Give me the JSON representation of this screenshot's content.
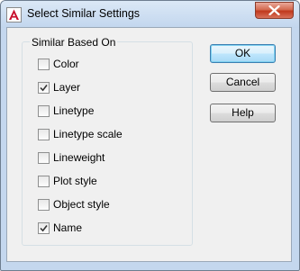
{
  "window": {
    "title": "Select Similar Settings"
  },
  "group": {
    "label": "Similar Based On"
  },
  "options": [
    {
      "label": "Color",
      "checked": false
    },
    {
      "label": "Layer",
      "checked": true
    },
    {
      "label": "Linetype",
      "checked": false
    },
    {
      "label": "Linetype scale",
      "checked": false
    },
    {
      "label": "Lineweight",
      "checked": false
    },
    {
      "label": "Plot style",
      "checked": false
    },
    {
      "label": "Object style",
      "checked": false
    },
    {
      "label": "Name",
      "checked": true
    }
  ],
  "buttons": {
    "ok": "OK",
    "cancel": "Cancel",
    "help": "Help"
  },
  "colors": {
    "title_bar": "#c4d7ee",
    "close": "#c0391d",
    "app_icon": "#c8102e",
    "default_button": "#3c7fb1"
  },
  "icons": {
    "app": "autocad-icon",
    "close": "close-icon",
    "check": "check-icon"
  }
}
